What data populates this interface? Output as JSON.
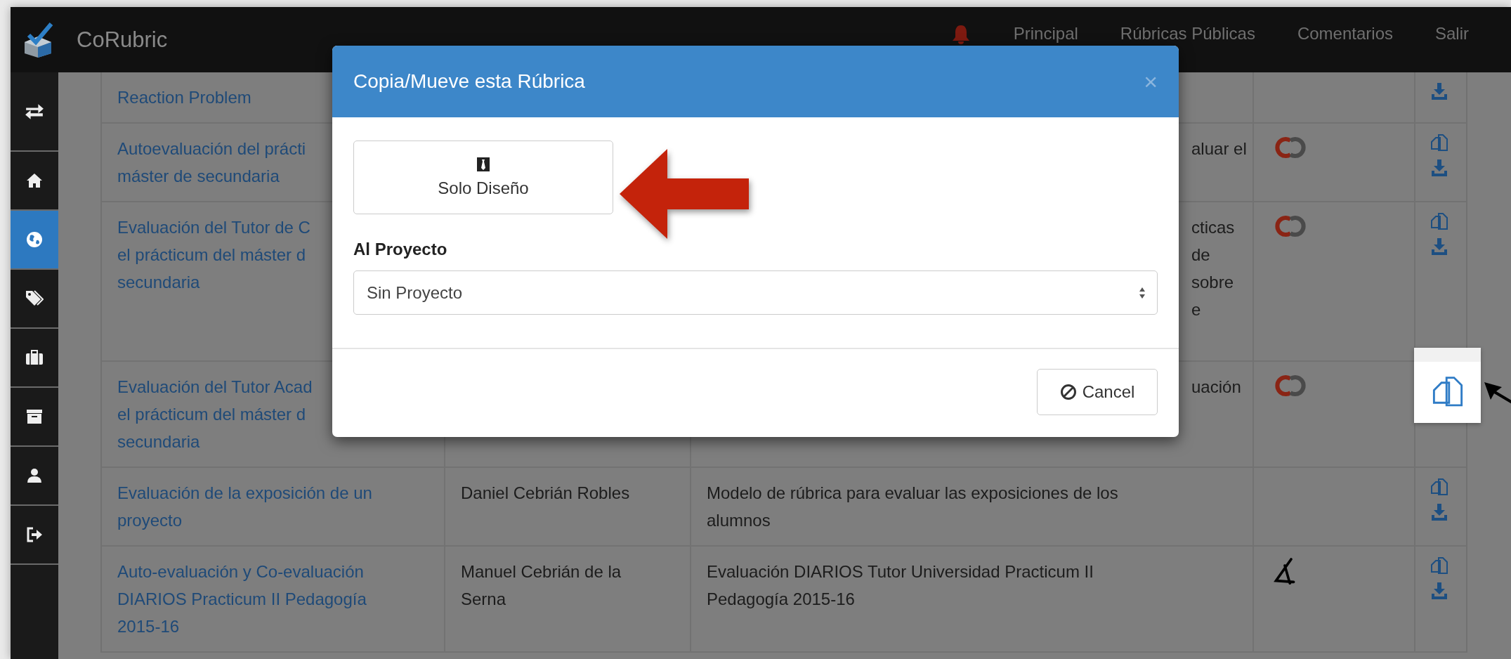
{
  "navbar": {
    "brand": "CoRubric",
    "links": [
      "Principal",
      "Rúbricas Públicas",
      "Comentarios",
      "Salir"
    ]
  },
  "sidebar": {
    "items": [
      {
        "kind": "swap",
        "selected": false
      },
      {
        "kind": "home",
        "selected": false
      },
      {
        "kind": "globe",
        "selected": true
      },
      {
        "kind": "tags",
        "selected": false
      },
      {
        "kind": "briefcase",
        "selected": false
      },
      {
        "kind": "archive",
        "selected": false
      },
      {
        "kind": "user",
        "selected": false
      },
      {
        "kind": "logout",
        "selected": false
      }
    ]
  },
  "table": {
    "rows": [
      {
        "kind": "covered",
        "title": "Reaction Problem",
        "actions": [
          {
            "kind": "download"
          }
        ]
      },
      {
        "kind": "covered",
        "title": "Autoevaluación del prácti\nmáster de secundaria",
        "description": "aluar el",
        "license": {
          "kind": "cc"
        },
        "actions": [
          {
            "kind": "copy"
          },
          {
            "kind": "download"
          }
        ]
      },
      {
        "kind": "covered",
        "title": "Evaluación del Tutor de C\nel prácticum del máster d\nsecundaria",
        "description": "cticas\nde\nsobre\ne",
        "license": {
          "kind": "cc"
        },
        "actions": [
          {
            "kind": "copy"
          },
          {
            "kind": "download"
          }
        ]
      },
      {
        "kind": "covered",
        "title": "Evaluación del Tutor Acad\nel prácticum del máster d\nsecundaria",
        "description": "uación",
        "license": {
          "kind": "cc"
        }
      },
      {
        "kind": "full",
        "title": "Evaluación de la exposición de un\nproyecto",
        "author": "Daniel Cebrián Robles",
        "description": "Modelo de rúbrica para evaluar las exposiciones de los\nalumnos",
        "actions": [
          {
            "kind": "copy"
          },
          {
            "kind": "download"
          }
        ]
      },
      {
        "kind": "full",
        "title": "Auto-evaluación y Co-evaluación\nDIARIOS Practicum II Pedagogía\n2015-16",
        "author": "Manuel Cebrián de la\nSerna",
        "description": "Evaluación DIARIOS Tutor Universidad Practicum II\nPedagogía 2015-16",
        "license": {
          "kind": "sketch"
        },
        "actions": [
          {
            "kind": "copy"
          },
          {
            "kind": "download"
          }
        ]
      }
    ]
  },
  "modal": {
    "title": "Copia/Mueve esta Rúbrica",
    "close": "×",
    "design_button": "Solo Diseño",
    "project_label": "Al Proyecto",
    "project_select": {
      "value": "Sin Proyecto"
    },
    "cancel_button": "Cancel"
  }
}
